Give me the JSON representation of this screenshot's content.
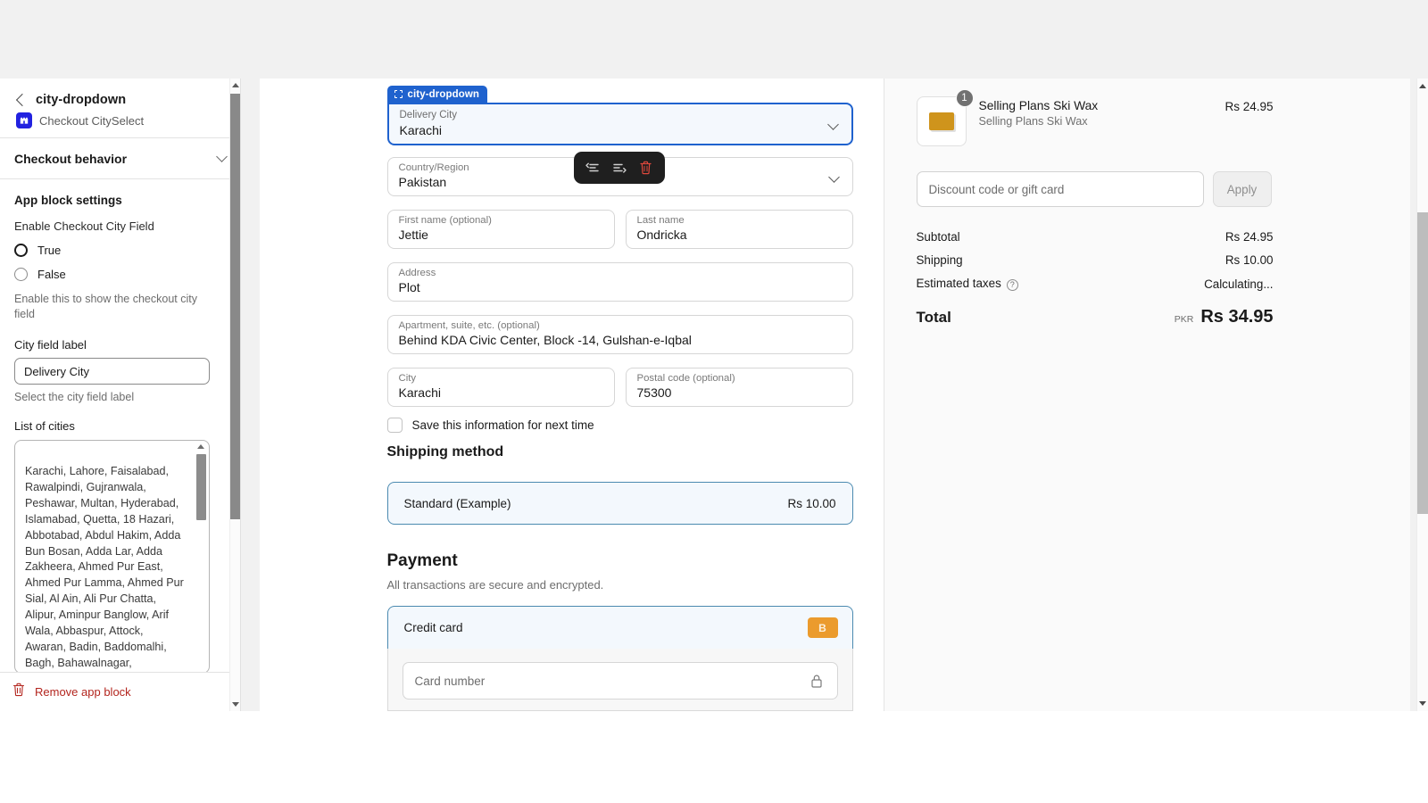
{
  "sidebar": {
    "back_icon": "chevron-left-icon",
    "title": "city-dropdown",
    "app_icon": "checkout-cityselect-app-icon",
    "app_name": "Checkout CitySelect",
    "section": {
      "title": "Checkout behavior",
      "chevron": "chevron-down-icon"
    },
    "settings_heading": "App block settings",
    "enable_label": "Enable Checkout City Field",
    "radio_true": "True",
    "radio_false": "False",
    "radio_selected": "True",
    "enable_help": "Enable this to show the checkout city field",
    "city_label_title": "City field label",
    "city_label_value": "Delivery City",
    "city_label_placeholder": "Delivery City",
    "city_label_help": "Select the city field label",
    "cities_title": "List of cities",
    "cities_value": "Karachi, Lahore, Faisalabad, Rawalpindi, Gujranwala, Peshawar, Multan, Hyderabad, Islamabad, Quetta, 18 Hazari, Abbotabad, Abdul Hakim, Adda Bun Bosan, Adda Lar, Adda Zakheera, Ahmed Pur East, Ahmed Pur Lamma, Ahmed Pur Sial, Al Ain, Ali Pur Chatta, Alipur, Aminpur Banglow, Arif Wala, Abbaspur, Attock, Awaran, Badin, Baddomalhi, Bagh, Bahawalnagar,",
    "remove_label": "Remove app block",
    "remove_icon": "trash-icon",
    "remove_color": "#b3251e"
  },
  "selected_block": {
    "badge_label": "city-dropdown",
    "badge_icon": "app-block-icon",
    "badge_color": "#1f62ce",
    "field_label": "Delivery City",
    "field_value": "Karachi",
    "chevron": "chevron-down-icon"
  },
  "toolbar": {
    "buttons": [
      {
        "icon": "move-block-up-icon",
        "name": "move-up-button"
      },
      {
        "icon": "move-block-down-icon",
        "name": "move-down-button"
      },
      {
        "icon": "trash-icon",
        "name": "delete-block-button"
      }
    ]
  },
  "checkout": {
    "country": {
      "label": "Country/Region",
      "value": "Pakistan",
      "chevron": "chevron-down-icon"
    },
    "first_name": {
      "label": "First name (optional)",
      "value": "Jettie"
    },
    "last_name": {
      "label": "Last name",
      "value": "Ondricka"
    },
    "address": {
      "label": "Address",
      "value": "Plot"
    },
    "apartment": {
      "label": "Apartment, suite, etc. (optional)",
      "value": "Behind KDA Civic Center, Block -14, Gulshan-e-Iqbal"
    },
    "city": {
      "label": "City",
      "value": "Karachi"
    },
    "postal": {
      "label": "Postal code (optional)",
      "value": "75300"
    },
    "save_info_label": "Save this information for next time",
    "save_info_checked": false,
    "shipping_heading": "Shipping method",
    "shipping_option": {
      "name": "Standard (Example)",
      "price": "Rs 10.00"
    },
    "payment_heading": "Payment",
    "payment_sub": "All transactions are secure and encrypted.",
    "payment_option": {
      "name": "Credit card",
      "badge": "B",
      "badge_color": "#eb9b2d"
    },
    "card_number_placeholder": "Card number",
    "card_lock_icon": "lock-icon"
  },
  "summary": {
    "item": {
      "title": "Selling Plans Ski Wax",
      "variant": "Selling Plans Ski Wax",
      "price": "Rs 24.95",
      "quantity": "1",
      "thumb_icon": "product-thumbnail"
    },
    "discount_placeholder": "Discount code or gift card",
    "discount_value": "",
    "apply_label": "Apply",
    "rows": [
      {
        "label": "Subtotal",
        "value": "Rs 24.95"
      },
      {
        "label": "Shipping",
        "value": "Rs 10.00"
      },
      {
        "label": "Estimated taxes",
        "value": "Calculating...",
        "info_icon": "info-icon"
      }
    ],
    "total_label": "Total",
    "total_currency": "PKR",
    "total_value": "Rs 34.95"
  }
}
